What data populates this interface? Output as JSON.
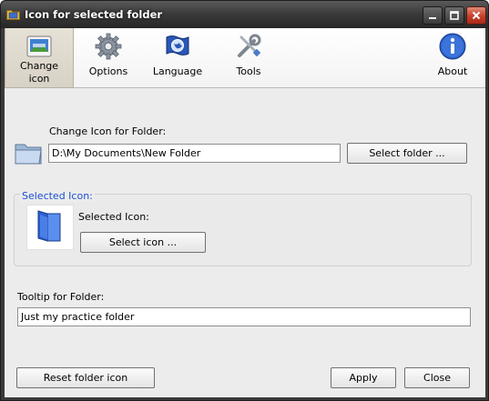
{
  "window": {
    "title": "Icon for selected folder",
    "title_icon": "folder-app-icon",
    "controls": [
      "minimize-icon",
      "maximize-icon",
      "close-icon"
    ]
  },
  "toolbar": {
    "items": [
      {
        "label_line1": "Change",
        "label_line2": "icon",
        "icon": "folder-picture-icon",
        "active": true
      },
      {
        "label": "Options",
        "icon": "gear-icon"
      },
      {
        "label": "Language",
        "icon": "globe-flag-icon"
      },
      {
        "label": "Tools",
        "icon": "tools-icon"
      },
      {
        "label": "About",
        "icon": "info-icon"
      }
    ]
  },
  "folder_section": {
    "label": "Change Icon for Folder:",
    "path_value": "D:\\My Documents\\New Folder",
    "select_folder_button": "Select folder ..."
  },
  "selected_icon_group": {
    "title": "Selected Icon:",
    "label": "Selected Icon:",
    "select_icon_button": "Select icon ..."
  },
  "tooltip_section": {
    "label": "Tooltip for Folder:",
    "value": "Just my practice folder"
  },
  "footer": {
    "reset_button": "Reset folder icon",
    "apply_button": "Apply",
    "close_button": "Close"
  },
  "colors": {
    "titlebar": "#3c3c3c",
    "client_bg": "#ececec",
    "group_title": "#1b4fd1",
    "active_tab": "#d8d2c6"
  }
}
